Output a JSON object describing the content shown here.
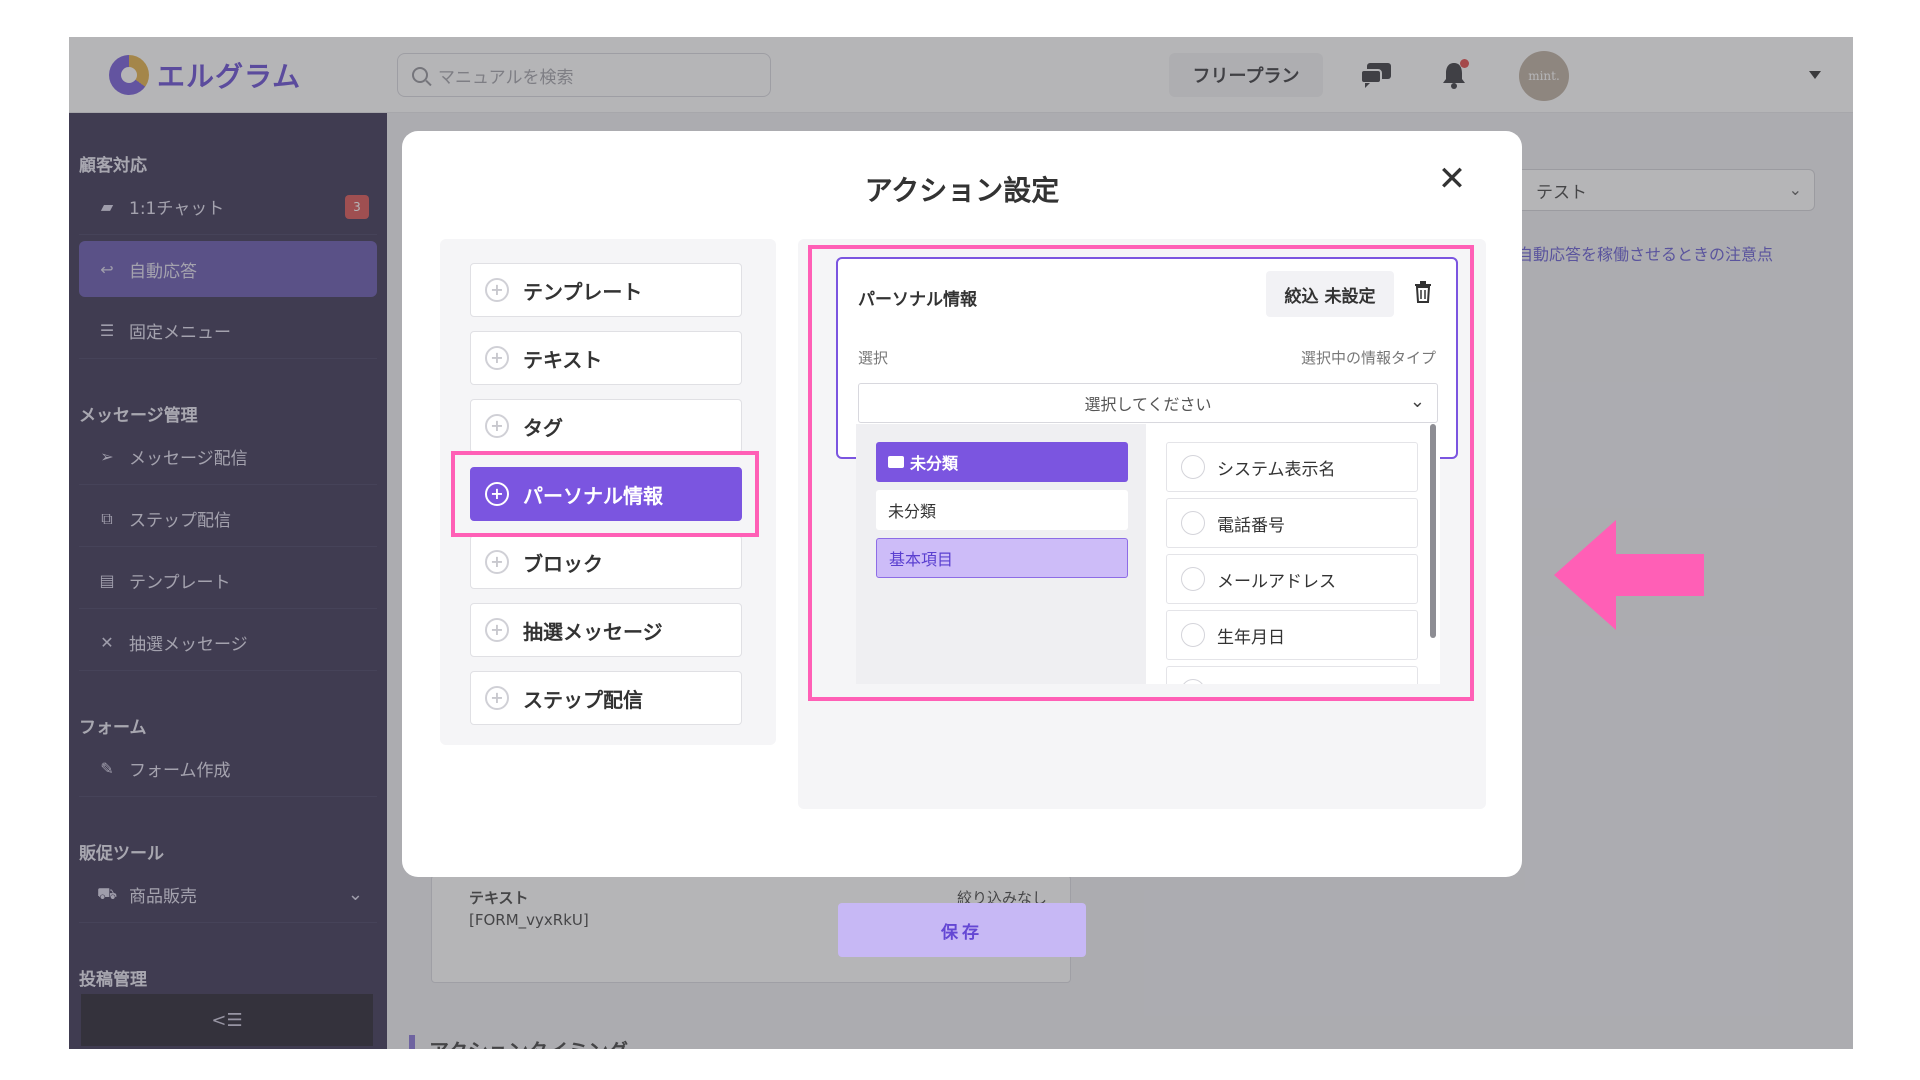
{
  "header": {
    "logo_text": "エルグラム",
    "search_placeholder": "マニュアルを検索",
    "plan_label": "フリープラン",
    "avatar_text": "mint."
  },
  "sidebar": {
    "sections": {
      "customer": "顧客対応",
      "message": "メッセージ管理",
      "form": "フォーム",
      "promo": "販促ツール",
      "post": "投稿管理"
    },
    "items": [
      {
        "label": "1:1チャット",
        "icon": "chat-icon",
        "badge": "3"
      },
      {
        "label": "自動応答",
        "icon": "reply-icon"
      },
      {
        "label": "固定メニュー",
        "icon": "menu-icon"
      },
      {
        "label": "メッセージ配信",
        "icon": "send-icon"
      },
      {
        "label": "ステップ配信",
        "icon": "step-icon"
      },
      {
        "label": "テンプレート",
        "icon": "template-icon"
      },
      {
        "label": "抽選メッセージ",
        "icon": "shuffle-icon"
      },
      {
        "label": "フォーム作成",
        "icon": "form-icon"
      },
      {
        "label": "商品販売",
        "icon": "cart-icon"
      }
    ],
    "collapse_glyph": "<☰"
  },
  "background": {
    "select_value": "テスト",
    "link_text": "に自動応答を稼働させるときの注意点",
    "row_title": "テキスト",
    "row_value": "[FORM_vyxRkU]",
    "row_filter": "絞り込みなし",
    "save_label": "保存",
    "section_heading": "アクションタイミング"
  },
  "modal": {
    "title": "アクション設定",
    "close_glyph": "✕",
    "actions": [
      "テンプレート",
      "テキスト",
      "タグ",
      "パーソナル情報",
      "ブロック",
      "抽選メッセージ",
      "ステップ配信"
    ],
    "active_action": "パーソナル情報",
    "card": {
      "title": "パーソナル情報",
      "filter_label": "絞込 未設定",
      "label_select": "選択",
      "label_type": "選択中の情報タイプ",
      "dropdown_placeholder": "選択してください"
    },
    "categories": [
      "未分類",
      "未分類",
      "基本項目"
    ],
    "options": [
      "システム表示名",
      "電話番号",
      "メールアドレス",
      "生年月日"
    ]
  },
  "colors": {
    "accent": "#7b55e0",
    "highlight": "#ff5fb6",
    "sidebar_bg": "#2a2346"
  }
}
